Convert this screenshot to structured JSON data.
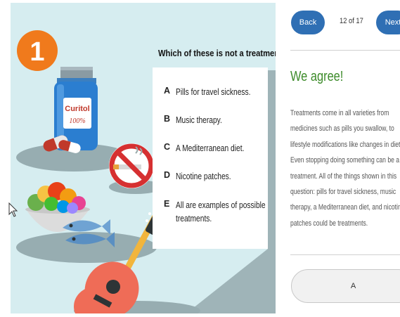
{
  "question": {
    "number": "1",
    "title": "Which of these is not a treatment?",
    "options": [
      {
        "letter": "A",
        "text": "Pills for travel sickness."
      },
      {
        "letter": "B",
        "text": "Music therapy."
      },
      {
        "letter": "C",
        "text": "A Mediterranean diet."
      },
      {
        "letter": "D",
        "text": "Nicotine patches."
      },
      {
        "letter": "E",
        "text_line1": "All are examples of possible",
        "text_line2": "treatments."
      }
    ]
  },
  "illustration": {
    "pill_bottle_brand": "Curitol",
    "pill_bottle_strength": "100%"
  },
  "nav": {
    "back_label": "Back",
    "next_label": "Next",
    "page_indicator": "12 of 17"
  },
  "feedback": {
    "title": "We agree!",
    "lines": [
      "Treatments come in all varieties from",
      "medicines such as pills you swallow, to",
      "lifestyle modifications like changes in diet.",
      "Even stopping doing something can be a",
      "treatment. All of the things shown in this",
      "question: pills for travel sickness, music",
      "therapy, a Mediterranean diet, and nicotine",
      "patches could be treatments."
    ]
  },
  "answer": {
    "selected_label": "A"
  },
  "colors": {
    "panel_bg": "#d6edf0",
    "badge": "#f07a1c",
    "nav_button": "#2f6fb4",
    "feedback_title": "#3d8b2a"
  }
}
